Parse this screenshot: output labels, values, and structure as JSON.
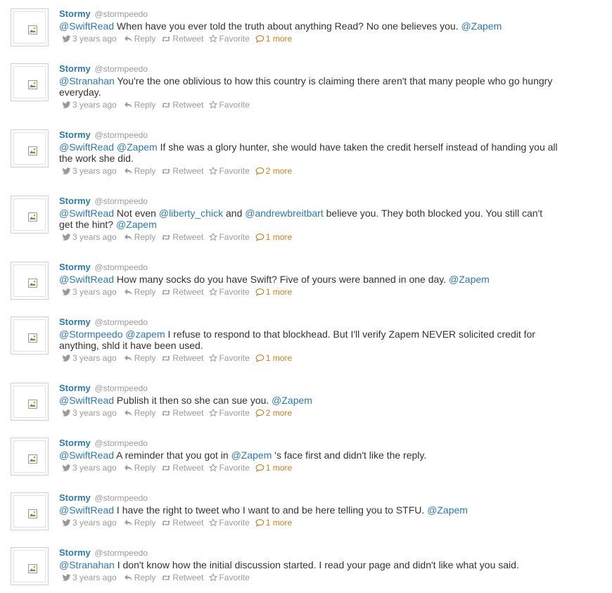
{
  "labels": {
    "reply": "Reply",
    "retweet": "Retweet",
    "favorite": "Favorite"
  },
  "colors": {
    "link": "#2a79b3",
    "meta": "#9a9a9a",
    "more": "#d07d1a"
  },
  "tweets": [
    {
      "name": "Stormy",
      "handle": "@stormpeedo",
      "time": "3 years ago",
      "more": "1 more",
      "segments": [
        {
          "t": "@SwiftRead",
          "m": true
        },
        {
          "t": " When have you ever told the truth about anything Read? No one believes you. "
        },
        {
          "t": "@Zapem",
          "m": true
        }
      ]
    },
    {
      "name": "Stormy",
      "handle": "@stormpeedo",
      "time": "3 years ago",
      "more": "",
      "segments": [
        {
          "t": "@Stranahan",
          "m": true
        },
        {
          "t": " You're the one oblivious to how this country is claiming there aren't that many people who go hungry everyday."
        }
      ]
    },
    {
      "name": "Stormy",
      "handle": "@stormpeedo",
      "time": "3 years ago",
      "more": "2 more",
      "segments": [
        {
          "t": "@SwiftRead",
          "m": true
        },
        {
          "t": " "
        },
        {
          "t": "@Zapem",
          "m": true
        },
        {
          "t": " If she was a glory hunter, she would have taken the credit herself instead of handing you all the work she did."
        }
      ]
    },
    {
      "name": "Stormy",
      "handle": "@stormpeedo",
      "time": "3 years ago",
      "more": "1 more",
      "segments": [
        {
          "t": "@SwiftRead",
          "m": true
        },
        {
          "t": " Not even "
        },
        {
          "t": "@liberty_chick",
          "m": true
        },
        {
          "t": " and "
        },
        {
          "t": "@andrewbreitbart",
          "m": true
        },
        {
          "t": " believe you. They both blocked you. You still can't get the hint? "
        },
        {
          "t": "@Zapem",
          "m": true
        }
      ]
    },
    {
      "name": "Stormy",
      "handle": "@stormpeedo",
      "time": "3 years ago",
      "more": "1 more",
      "segments": [
        {
          "t": "@SwiftRead",
          "m": true
        },
        {
          "t": " How many socks do you have Swift? Five of yours were banned in one day. "
        },
        {
          "t": "@Zapem",
          "m": true
        }
      ]
    },
    {
      "name": "Stormy",
      "handle": "@stormpeedo",
      "time": "3 years ago",
      "more": "1 more",
      "segments": [
        {
          "t": "@Stormpeedo",
          "m": true
        },
        {
          "t": " "
        },
        {
          "t": "@zapem",
          "m": true
        },
        {
          "t": " I refuse to respond to that blockhead. But I'll verify Zapem NEVER solicited credit for anything, shld it have been used."
        }
      ]
    },
    {
      "name": "Stormy",
      "handle": "@stormpeedo",
      "time": "3 years ago",
      "more": "2 more",
      "segments": [
        {
          "t": "@SwiftRead",
          "m": true
        },
        {
          "t": " Publish it then so she can sue you. "
        },
        {
          "t": "@Zapem",
          "m": true
        }
      ]
    },
    {
      "name": "Stormy",
      "handle": "@stormpeedo",
      "time": "3 years ago",
      "more": "1 more",
      "segments": [
        {
          "t": "@SwiftRead",
          "m": true
        },
        {
          "t": " A reminder that you got in "
        },
        {
          "t": "@Zapem",
          "m": true
        },
        {
          "t": " 's face first and didn't like the reply."
        }
      ]
    },
    {
      "name": "Stormy",
      "handle": "@stormpeedo",
      "time": "3 years ago",
      "more": "1 more",
      "segments": [
        {
          "t": "@SwiftRead",
          "m": true
        },
        {
          "t": " I have the right to tweet who I want to and be here telling you to STFU. "
        },
        {
          "t": "@Zapem",
          "m": true
        }
      ]
    },
    {
      "name": "Stormy",
      "handle": "@stormpeedo",
      "time": "3 years ago",
      "more": "",
      "segments": [
        {
          "t": "@Stranahan",
          "m": true
        },
        {
          "t": " I don't know how the initial discussion started. I read your page and didn't like what you said."
        }
      ]
    }
  ]
}
